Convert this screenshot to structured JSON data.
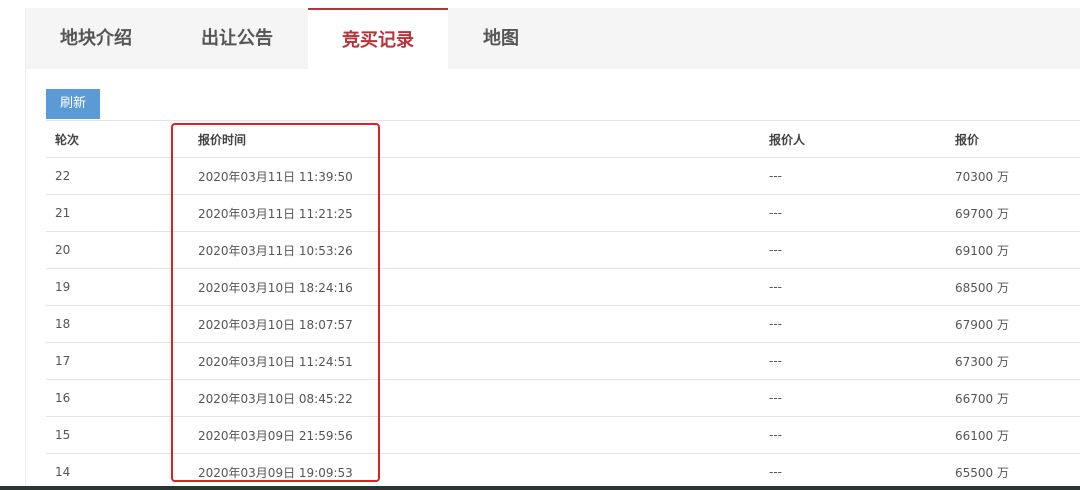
{
  "tabs": [
    {
      "label": "地块介绍"
    },
    {
      "label": "出让公告"
    },
    {
      "label": "竞买记录",
      "active": true
    },
    {
      "label": "地图"
    }
  ],
  "refresh_label": "刷新",
  "columns": [
    "轮次",
    "报价时间",
    "报价人",
    "报价"
  ],
  "rows": [
    [
      "22",
      "2020年03月11日 11:39:50",
      "---",
      "70300 万"
    ],
    [
      "21",
      "2020年03月11日 11:21:25",
      "---",
      "69700 万"
    ],
    [
      "20",
      "2020年03月11日 10:53:26",
      "---",
      "69100 万"
    ],
    [
      "19",
      "2020年03月10日 18:24:16",
      "---",
      "68500 万"
    ],
    [
      "18",
      "2020年03月10日 18:07:57",
      "---",
      "67900 万"
    ],
    [
      "17",
      "2020年03月10日 11:24:51",
      "---",
      "67300 万"
    ],
    [
      "16",
      "2020年03月10日 08:45:22",
      "---",
      "66700 万"
    ],
    [
      "15",
      "2020年03月09日 21:59:56",
      "---",
      "66100 万"
    ],
    [
      "14",
      "2020年03月09日 19:09:53",
      "---",
      "65500 万"
    ]
  ],
  "colors": {
    "accent": "#b8323a",
    "button": "#5b9bd5",
    "highlight": "#e02020"
  }
}
